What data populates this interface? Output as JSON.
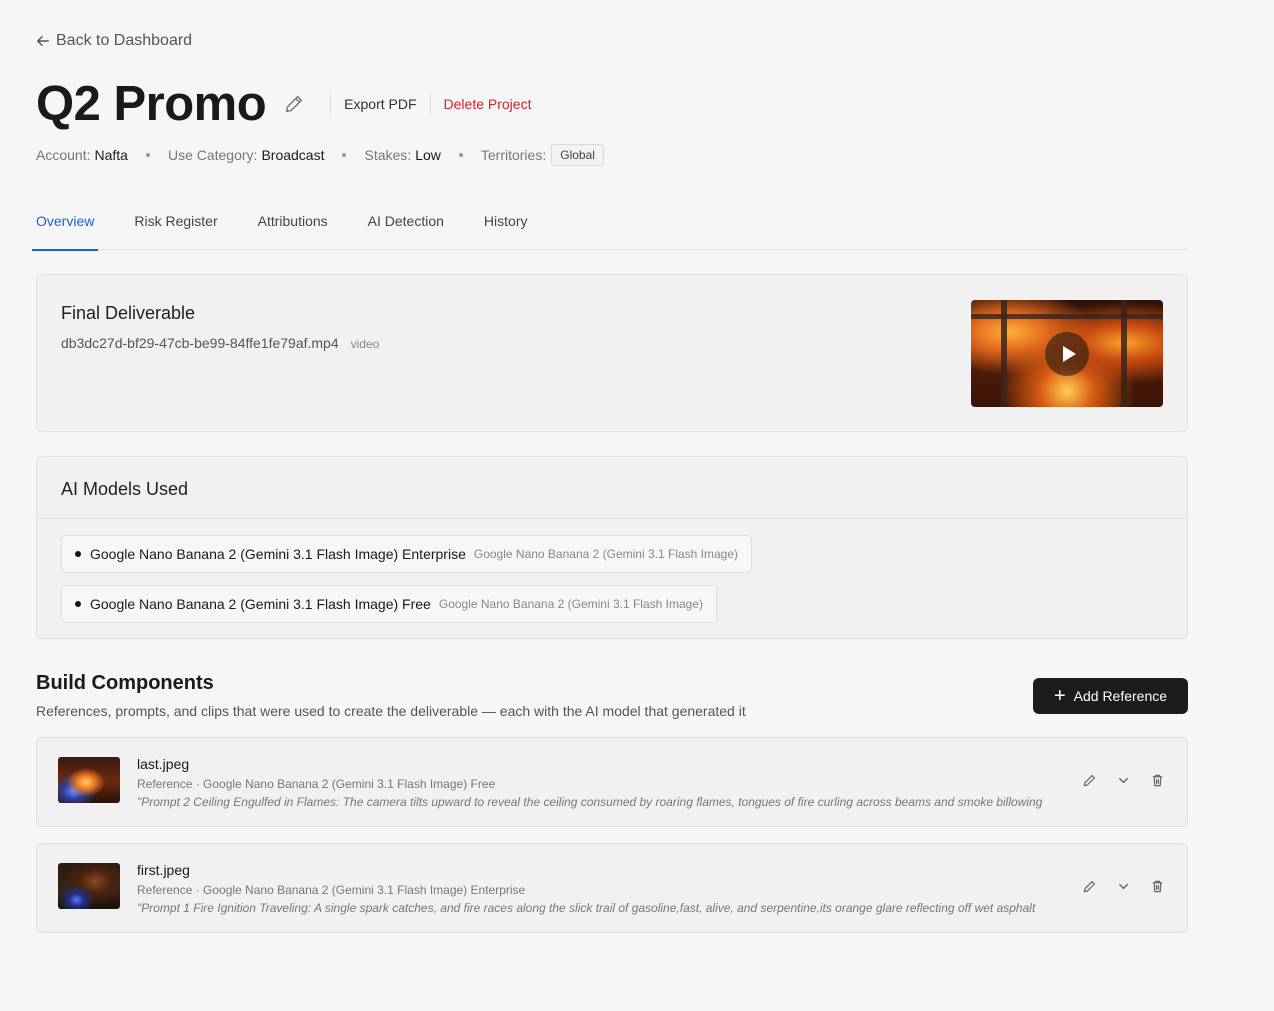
{
  "nav": {
    "back_label": "Back to Dashboard"
  },
  "project": {
    "title": "Q2 Promo",
    "actions": {
      "export_label": "Export PDF",
      "delete_label": "Delete Project"
    },
    "meta": {
      "account_label": "Account:",
      "account_value": "Nafta",
      "use_label": "Use Category:",
      "use_value": "Broadcast",
      "stakes_label": "Stakes:",
      "stakes_value": "Low",
      "territories_label": "Territories:",
      "territories_value": "Global"
    }
  },
  "tabs": [
    {
      "label": "Overview",
      "active": true
    },
    {
      "label": "Risk Register"
    },
    {
      "label": "Attributions"
    },
    {
      "label": "AI Detection"
    },
    {
      "label": "History"
    }
  ],
  "deliverable": {
    "heading": "Final Deliverable",
    "filename": "db3dc27d-bf29-47cb-be99-84ffe1fe79af.mp4",
    "kind": "video"
  },
  "models": {
    "heading": "AI Models Used",
    "items": [
      {
        "name": "Google Nano Banana 2 (Gemini 3.1 Flash Image) Enterprise",
        "base": "Google Nano Banana 2 (Gemini 3.1 Flash Image)"
      },
      {
        "name": "Google Nano Banana 2 (Gemini 3.1 Flash Image) Free",
        "base": "Google Nano Banana 2 (Gemini 3.1 Flash Image)"
      }
    ]
  },
  "build": {
    "heading": "Build Components",
    "subtitle": "References, prompts, and clips that were used to create the deliverable — each with the AI model that generated it",
    "add_label": "Add Reference",
    "items": [
      {
        "name": "last.jpeg",
        "meta": "Reference · Google Nano Banana 2 (Gemini 3.1 Flash Image) Free",
        "prompt": "\"Prompt 2 Ceiling Engulfed in Flames: The camera tilts upward to reveal the ceiling consumed by roaring flames, tongues of fire curling across beams and smoke billowing"
      },
      {
        "name": "first.jpeg",
        "meta": "Reference · Google Nano Banana 2 (Gemini 3.1 Flash Image) Enterprise",
        "prompt": "\"Prompt 1 Fire Ignition Traveling: A single spark catches, and fire races along the slick trail of gasoline,fast, alive, and serpentine,its orange glare reflecting off wet asphalt"
      }
    ]
  },
  "colors": {
    "accent": "#1f5fd6",
    "danger": "#d3212c",
    "button_bg": "#1c1c1c"
  }
}
